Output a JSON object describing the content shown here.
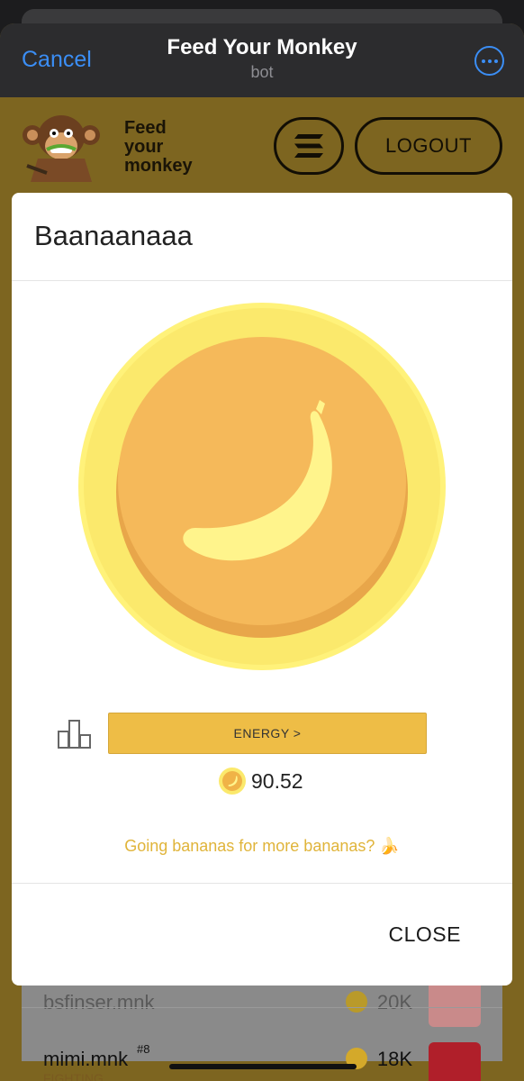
{
  "telegram": {
    "cancel_label": "Cancel",
    "title": "Feed Your Monkey",
    "subtitle": "bot"
  },
  "app_bar": {
    "brand_line1": "Feed",
    "brand_line2": "your",
    "brand_line3": "monkey",
    "logout_label": "LOGOUT"
  },
  "modal": {
    "title": "Baanaanaaa",
    "energy_label": "ENERGY >",
    "balance": "90.52",
    "promo_text": "Going bananas for more bananas? 🍌",
    "close_label": "CLOSE"
  },
  "leaderboard": {
    "rows": [
      {
        "name": "bsfinser.mnk",
        "score": "20K",
        "rank": "",
        "status": ""
      },
      {
        "name": "mimi.mnk",
        "score": "18K",
        "rank": "#8",
        "status": "FIGHTING"
      }
    ]
  },
  "colors": {
    "accent": "#eebd46",
    "brand_bg": "#7d6520",
    "link": "#3b8ef5",
    "promo": "#e0b43a"
  }
}
